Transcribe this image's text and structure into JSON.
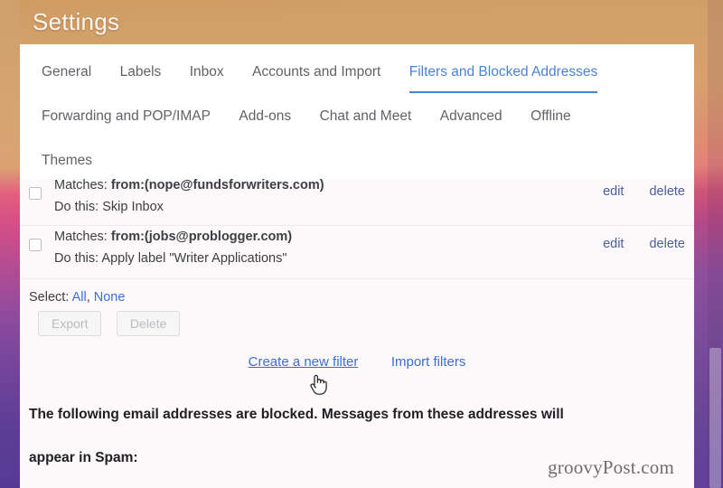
{
  "window": {
    "title": "Settings"
  },
  "theme": {
    "accent_blue": "#4a83d4",
    "link_blue": "#3b6fd4",
    "row_link_blue": "#4a5f9e",
    "panel_white": "#ffffff",
    "content_bg": "#fdf8fa",
    "title_text": "#fdf6ef",
    "tab_text": "#5f6368",
    "bg_top": "#cf9b63",
    "bg_mid": "#cf5578",
    "bg_bottom": "#63419b"
  },
  "tabs": {
    "rows": [
      [
        {
          "label": "General",
          "active": false
        },
        {
          "label": "Labels",
          "active": false
        },
        {
          "label": "Inbox",
          "active": false
        },
        {
          "label": "Accounts and Import",
          "active": false
        },
        {
          "label": "Filters and Blocked Addresses",
          "active": true
        }
      ],
      [
        {
          "label": "Forwarding and POP/IMAP",
          "active": false
        },
        {
          "label": "Add-ons",
          "active": false
        },
        {
          "label": "Chat and Meet",
          "active": false
        },
        {
          "label": "Advanced",
          "active": false
        },
        {
          "label": "Offline",
          "active": false
        }
      ],
      [
        {
          "label": "Themes",
          "active": false
        }
      ]
    ]
  },
  "filters": {
    "rows": [
      {
        "checked": false,
        "matches_label": "Matches:",
        "matches_value": "from:(nope@fundsforwriters.com)",
        "action_label": "Do this:",
        "action_value": "Skip Inbox",
        "edit_label": "edit",
        "delete_label": "delete"
      },
      {
        "checked": false,
        "matches_label": "Matches:",
        "matches_value": "from:(jobs@problogger.com)",
        "action_label": "Do this:",
        "action_value": "Apply label \"Writer Applications\"",
        "edit_label": "edit",
        "delete_label": "delete"
      }
    ]
  },
  "select_bar": {
    "prefix": "Select:",
    "all_label": "All",
    "separator": ",",
    "none_label": "None"
  },
  "buttons": {
    "export_label": "Export",
    "delete_label": "Delete",
    "export_disabled": true,
    "delete_disabled": true
  },
  "links": {
    "create_filter": "Create a new filter",
    "import_filters": "Import filters"
  },
  "blocked_section": {
    "line1": "The following email addresses are blocked. Messages from these addresses will",
    "line2": "appear in Spam:"
  },
  "watermark": {
    "text": "groovyPost.com"
  },
  "icons": {
    "cursor": "pointing-hand-cursor",
    "checkbox": "checkbox-unchecked"
  }
}
